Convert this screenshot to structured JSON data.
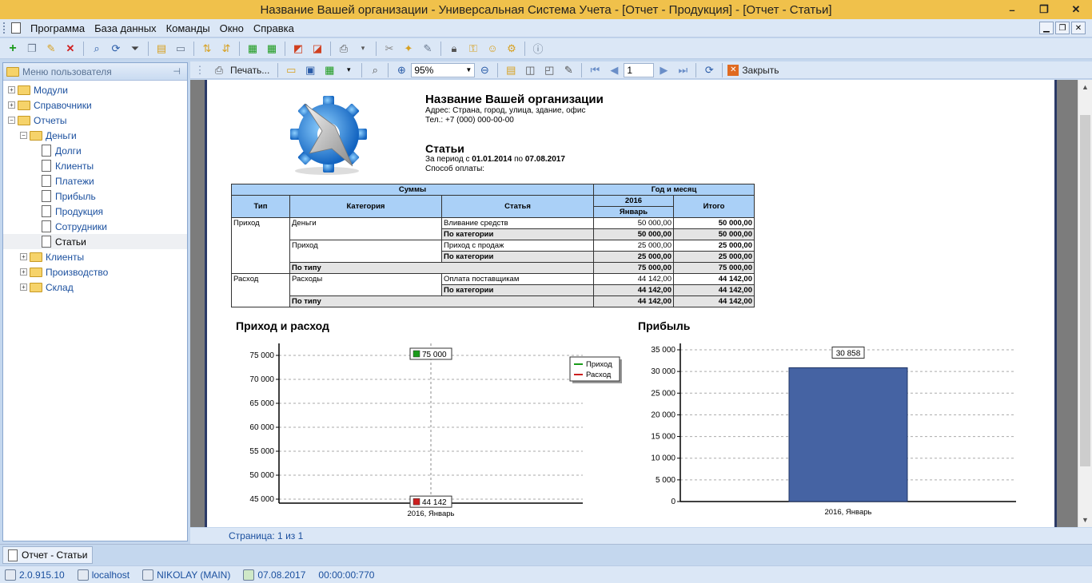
{
  "window": {
    "title": "Название Вашей организации - Универсальная Система Учета - [Отчет - Продукция] - [Отчет - Статьи]",
    "controls": [
      "–",
      "❐",
      "✕"
    ]
  },
  "menu": [
    "Программа",
    "База данных",
    "Команды",
    "Окно",
    "Справка"
  ],
  "sidebar": {
    "header": "Меню пользователя",
    "items": [
      {
        "label": "Модули",
        "level": 0,
        "expander": "+",
        "type": "folder"
      },
      {
        "label": "Справочники",
        "level": 0,
        "expander": "+",
        "type": "folder"
      },
      {
        "label": "Отчеты",
        "level": 0,
        "expander": "−",
        "type": "folder"
      },
      {
        "label": "Деньги",
        "level": 1,
        "expander": "−",
        "type": "folder"
      },
      {
        "label": "Долги",
        "level": 2,
        "type": "page"
      },
      {
        "label": "Клиенты",
        "level": 2,
        "type": "page"
      },
      {
        "label": "Платежи",
        "level": 2,
        "type": "page"
      },
      {
        "label": "Прибыль",
        "level": 2,
        "type": "page"
      },
      {
        "label": "Продукция",
        "level": 2,
        "type": "page"
      },
      {
        "label": "Сотрудники",
        "level": 2,
        "type": "page"
      },
      {
        "label": "Статьи",
        "level": 2,
        "type": "page",
        "selected": true
      },
      {
        "label": "Клиенты",
        "level": 1,
        "expander": "+",
        "type": "folder"
      },
      {
        "label": "Производство",
        "level": 1,
        "expander": "+",
        "type": "folder"
      },
      {
        "label": "Склад",
        "level": 1,
        "expander": "+",
        "type": "folder"
      }
    ]
  },
  "preview_toolbar": {
    "print_label": "Печать...",
    "zoom": "95%",
    "page": "1",
    "close_label": "Закрыть"
  },
  "report": {
    "org_name": "Название Вашей организации",
    "org_address": "Адрес: Страна, город, улица, здание, офис",
    "org_phone": "Тел.: +7 (000) 000-00-00",
    "title": "Статьи",
    "period_prefix": "За период с ",
    "period_from": "01.01.2014",
    "period_mid": " по ",
    "period_to": "07.08.2017",
    "payment_method": "Способ оплаты:",
    "table": {
      "h_sums": "Суммы",
      "h_yearmonth": "Год и месяц",
      "h_type": "Тип",
      "h_category": "Категория",
      "h_article": "Статья",
      "h_year": "2016",
      "h_month": "Январь",
      "h_total": "Итого",
      "rows": [
        {
          "type": "Приход",
          "category": "Деньги",
          "article": "Вливание средств",
          "value": "50 000,00",
          "total": "50 000,00"
        },
        {
          "article": "По категории",
          "value": "50 000,00",
          "total": "50 000,00",
          "sub": true
        },
        {
          "category": "Приход",
          "article": "Приход с продаж",
          "value": "25 000,00",
          "total": "25 000,00"
        },
        {
          "article": "По категории",
          "value": "25 000,00",
          "total": "25 000,00",
          "sub": true
        },
        {
          "category": "По типу",
          "value": "75 000,00",
          "total": "75 000,00",
          "typeSub": true
        },
        {
          "type": "Расход",
          "category": "Расходы",
          "article": "Оплата поставщикам",
          "value": "44 142,00",
          "total": "44 142,00"
        },
        {
          "article": "По категории",
          "value": "44 142,00",
          "total": "44 142,00",
          "sub": true
        },
        {
          "category": "По типу",
          "value": "44 142,00",
          "total": "44 142,00",
          "typeSub": true
        }
      ]
    }
  },
  "chart_data": [
    {
      "type": "line",
      "title": "Приход и расход",
      "categories": [
        "2016, Январь"
      ],
      "series": [
        {
          "name": "Приход",
          "values": [
            75000
          ],
          "color": "#1a9b1a",
          "label": "75 000"
        },
        {
          "name": "Расход",
          "values": [
            44142
          ],
          "color": "#cc1f1f",
          "label": "44 142"
        }
      ],
      "ylim": [
        45000,
        75000
      ],
      "yticks": [
        45000,
        50000,
        55000,
        60000,
        65000,
        70000,
        75000
      ],
      "ytick_labels": [
        "45 000",
        "50 000",
        "55 000",
        "60 000",
        "65 000",
        "70 000",
        "75 000"
      ],
      "grid": true,
      "legend": "right"
    },
    {
      "type": "bar",
      "title": "Прибыль",
      "categories": [
        "2016, Январь"
      ],
      "values": [
        30858
      ],
      "label": "30 858",
      "color": "#4563a3",
      "ylim": [
        0,
        35000
      ],
      "yticks": [
        0,
        5000,
        10000,
        15000,
        20000,
        25000,
        30000,
        35000
      ],
      "ytick_labels": [
        "0",
        "5 000",
        "10 000",
        "15 000",
        "20 000",
        "25 000",
        "30 000",
        "35 000"
      ],
      "grid": true
    }
  ],
  "page_status": "Страница: 1 из 1",
  "tab": "Отчет - Статьи",
  "statusbar": {
    "version": "2.0.915.10",
    "server": "localhost",
    "user": "NIKOLAY (MAIN)",
    "date": "07.08.2017",
    "time": "00:00:00:770"
  }
}
